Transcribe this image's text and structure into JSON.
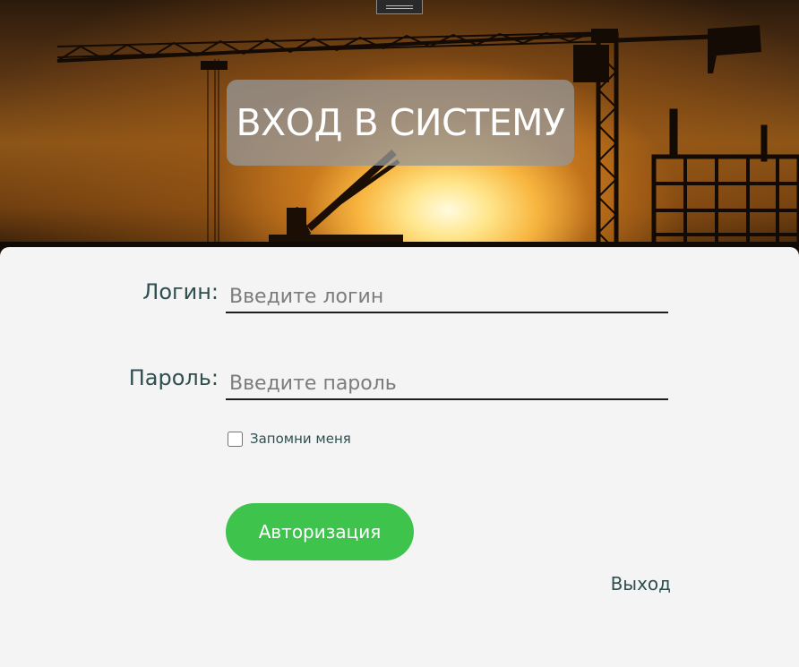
{
  "header": {
    "title": "ВХОД В СИСТЕМУ",
    "background_image": "construction-site-sunset"
  },
  "form": {
    "login": {
      "label": "Логин:",
      "placeholder": "Введите логин",
      "value": ""
    },
    "password": {
      "label": "Пароль:",
      "placeholder": "Введите пароль",
      "value": ""
    },
    "remember_me": {
      "label": "Запомни меня",
      "checked": false
    },
    "submit_label": "Авторизация",
    "exit_label": "Выход"
  },
  "colors": {
    "panel_background": "#f4f4f4",
    "label_text": "#2f4f4f",
    "button_background": "#3ec34d",
    "button_text": "#ffffff",
    "title_box": "#969696"
  }
}
